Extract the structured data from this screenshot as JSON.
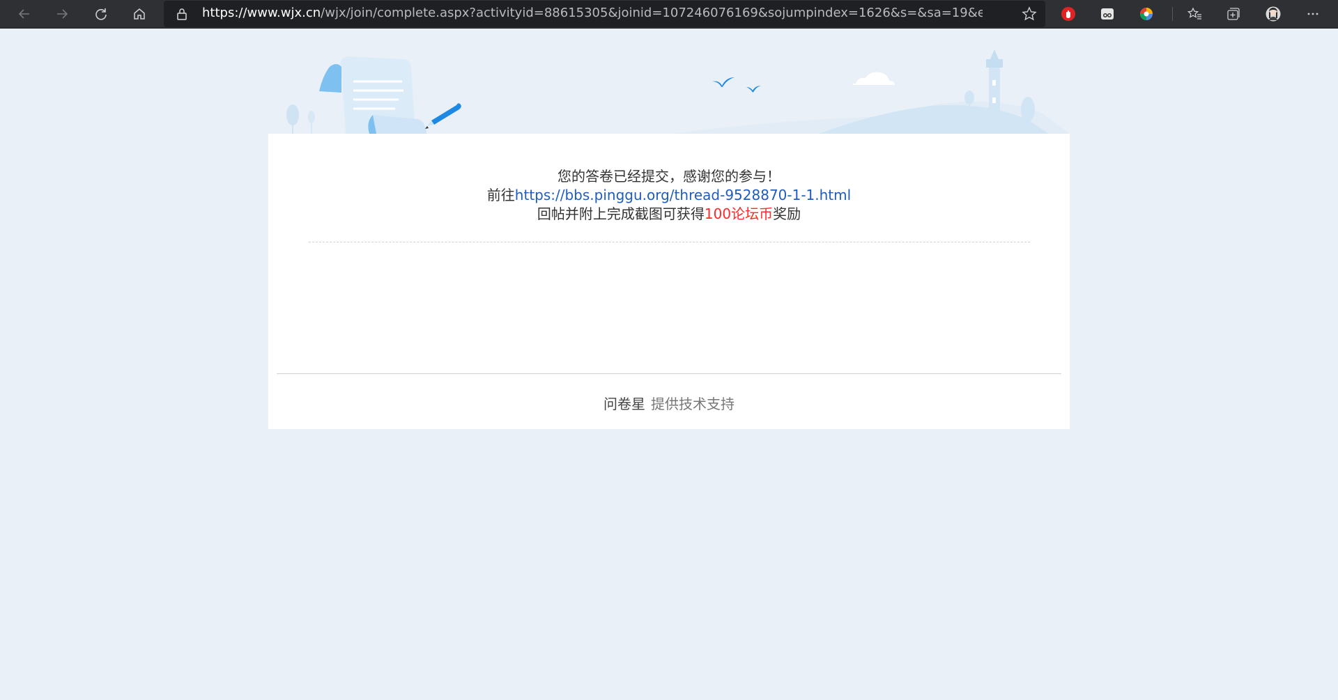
{
  "browser": {
    "url_host": "https://www.wjx.cn",
    "url_rest": "/wjx/join/complete.aspx?activityid=88615305&joinid=107246076169&sojumpindex=1626&s=&sa=19&ea=2..."
  },
  "message": {
    "line1": "您的答卷已经提交，感谢您的参与！",
    "line2_prefix": "前往",
    "link": "https://bbs.pinggu.org/thread-9528870-1-1.html",
    "line3_prefix": "回帖并附上完成截图可获得",
    "reward": "100论坛币",
    "line3_suffix": "奖励"
  },
  "footer": {
    "brand": "问卷星",
    "support": "提供技术支持"
  },
  "colors": {
    "page_bg": "#e9f0f7",
    "link": "#1f5dbd",
    "reward": "#ff2a2a"
  }
}
